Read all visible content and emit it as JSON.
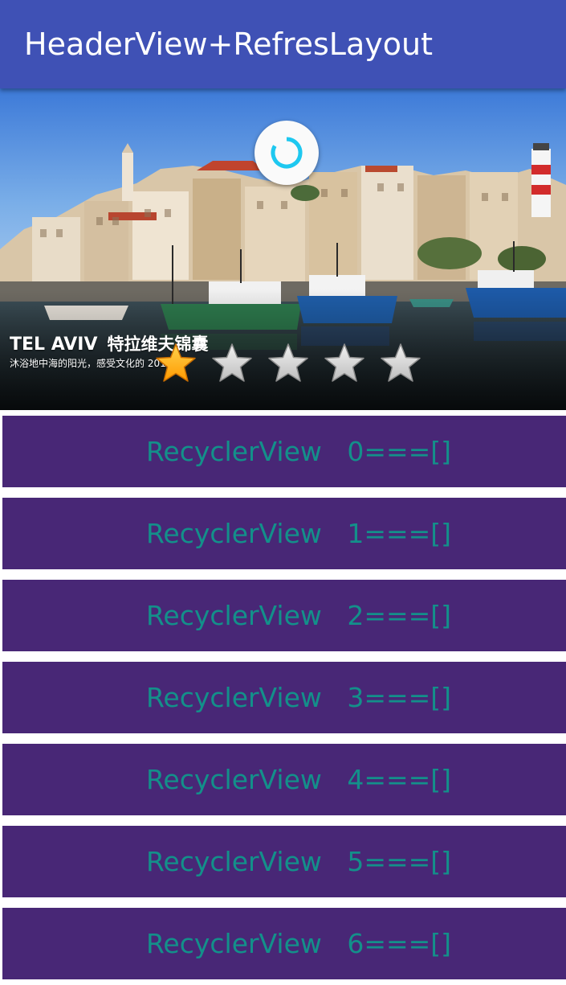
{
  "app_bar": {
    "title": "HeaderView+RefresLayout",
    "color": "#3f51b5"
  },
  "refresh_indicator": {
    "icon": "refresh-spinner-icon",
    "accent": "#1ec8f0"
  },
  "header": {
    "caption_title": "TEL AVIV",
    "caption_title_cn": "特拉维夫锦囊",
    "caption_subtitle": "沐浴地中海的阳光，感受文化的      2013",
    "rating": {
      "value": 1,
      "max": 5,
      "filled_color": "#ff9a00",
      "empty_color": "#bdbdbd"
    }
  },
  "list": {
    "row_color": "#482776",
    "text_color": "#13908a",
    "items": [
      {
        "label": "RecyclerView   0===[]"
      },
      {
        "label": "RecyclerView   1===[]"
      },
      {
        "label": "RecyclerView   2===[]"
      },
      {
        "label": "RecyclerView   3===[]"
      },
      {
        "label": "RecyclerView   4===[]"
      },
      {
        "label": "RecyclerView   5===[]"
      },
      {
        "label": "RecyclerView   6===[]"
      }
    ]
  }
}
